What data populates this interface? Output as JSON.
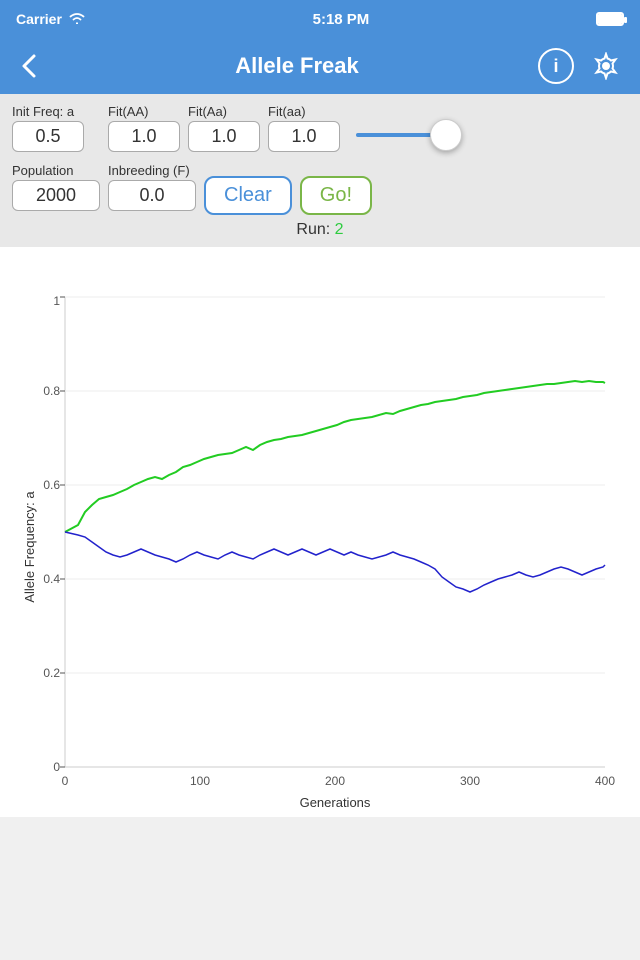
{
  "statusBar": {
    "carrier": "Carrier",
    "time": "5:18 PM"
  },
  "navBar": {
    "title": "Allele Freak",
    "backLabel": "←",
    "infoLabel": "i"
  },
  "controls": {
    "initFreqLabel": "Init Freq: a",
    "initFreqValue": "0.5",
    "fitAALabel": "Fit(AA)",
    "fitAAValue": "1.0",
    "fitAaLabel": "Fit(Aa)",
    "fitAaValue": "1.0",
    "fitaaLabel": "Fit(aa)",
    "fitaaValue": "1.0",
    "populationLabel": "Population",
    "populationValue": "2000",
    "inbreedingLabel": "Inbreeding (F)",
    "inbreedingValue": "0.0",
    "clearLabel": "Clear",
    "goLabel": "Go!",
    "runLabel": "Run:",
    "runValue": "2"
  },
  "chart": {
    "xLabel": "Generations",
    "yLabel": "Allele Frequency: a",
    "xTicks": [
      "0",
      "100",
      "200",
      "300",
      "400"
    ],
    "yTicks": [
      "0",
      "0.2",
      "0.4",
      "0.6",
      "0.8",
      "1"
    ]
  }
}
